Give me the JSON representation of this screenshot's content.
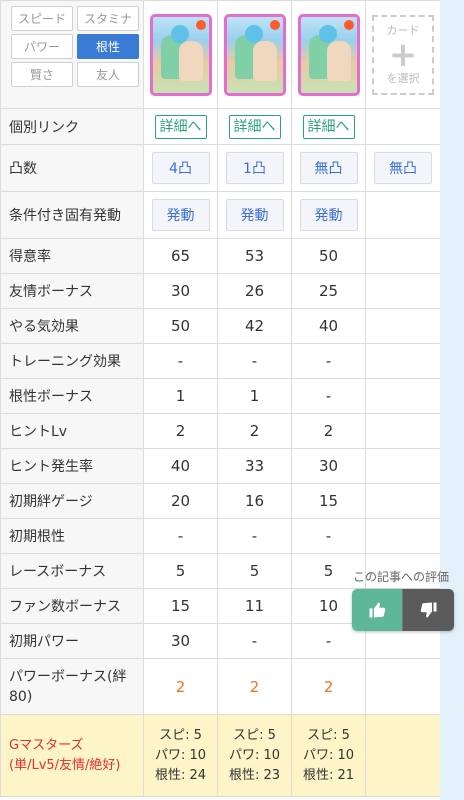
{
  "filters": [
    {
      "label": "スピード",
      "active": false
    },
    {
      "label": "スタミナ",
      "active": false
    },
    {
      "label": "パワー",
      "active": false
    },
    {
      "label": "根性",
      "active": true
    },
    {
      "label": "賢さ",
      "active": false
    },
    {
      "label": "友人",
      "active": false
    }
  ],
  "select_card": {
    "line1": "カード",
    "line2": "を選択"
  },
  "rows": {
    "link": {
      "label": "個別リンク",
      "button": "詳細へ"
    },
    "limit_break": {
      "label": "凸数",
      "values": [
        "4凸",
        "1凸",
        "無凸",
        "無凸"
      ]
    },
    "unique_effect": {
      "label": "条件付き固有発動",
      "button": "発動"
    },
    "specialty": {
      "label": "得意率",
      "values": [
        "65",
        "53",
        "50"
      ]
    },
    "friendship": {
      "label": "友情ボーナス",
      "values": [
        "30",
        "26",
        "25"
      ]
    },
    "motivation": {
      "label": "やる気効果",
      "values": [
        "50",
        "42",
        "40"
      ]
    },
    "training": {
      "label": "トレーニング効果",
      "values": [
        "-",
        "-",
        "-"
      ]
    },
    "guts_bonus": {
      "label": "根性ボーナス",
      "values": [
        "1",
        "1",
        "-"
      ]
    },
    "hint_lv": {
      "label": "ヒントLv",
      "values": [
        "2",
        "2",
        "2"
      ]
    },
    "hint_rate": {
      "label": "ヒント発生率",
      "values": [
        "40",
        "33",
        "30"
      ]
    },
    "initial_bond": {
      "label": "初期絆ゲージ",
      "values": [
        "20",
        "16",
        "15"
      ]
    },
    "initial_guts": {
      "label": "初期根性",
      "values": [
        "-",
        "-",
        "-"
      ]
    },
    "race_bonus": {
      "label": "レースボーナス",
      "values": [
        "5",
        "5",
        "5"
      ]
    },
    "fan_bonus": {
      "label": "ファン数ボーナス",
      "values": [
        "15",
        "11",
        "10"
      ]
    },
    "initial_power": {
      "label": "初期パワー",
      "values": [
        "30",
        "-",
        "-"
      ]
    },
    "power_bonus": {
      "label": "パワーボーナス(絆80)",
      "values": [
        "2",
        "2",
        "2"
      ]
    },
    "g_masters": {
      "label_line1": "Gマスターズ",
      "label_line2": "(単/Lv5/友情/絶好)",
      "values": [
        [
          "スピ: 5",
          "パワ: 10",
          "根性: 24"
        ],
        [
          "スピ: 5",
          "パワ: 10",
          "根性: 23"
        ],
        [
          "スピ: 5",
          "パワ: 10",
          "根性: 21"
        ]
      ]
    }
  },
  "rating": {
    "label": "この記事への評価"
  },
  "colors": {
    "accent_blue": "#3a7bd5",
    "link_green": "#2aa37a",
    "orange_value": "#e8751a",
    "gm_red": "#e03030",
    "gm_bg": "#fdf5c8"
  }
}
